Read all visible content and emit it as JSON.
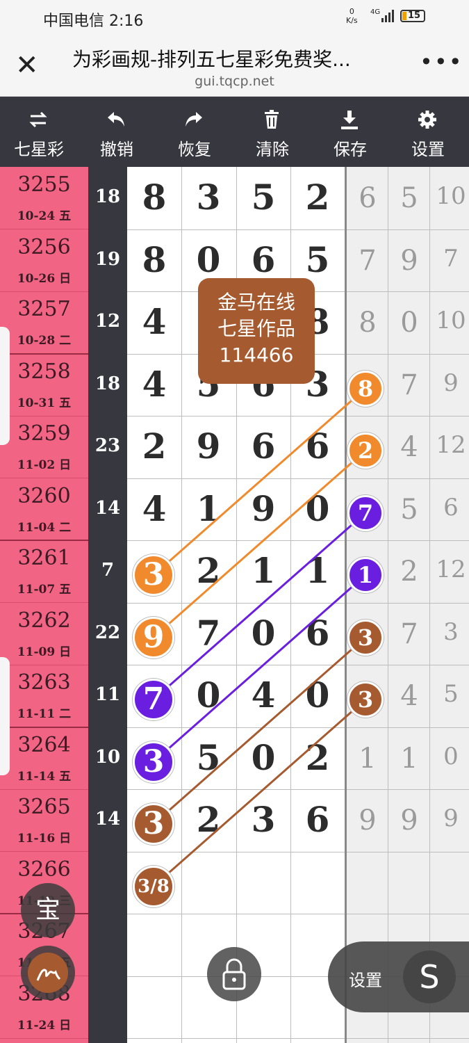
{
  "status_bar": {
    "carrier_time": "中国电信 2:16",
    "net_speed": "0",
    "net_unit": "K/s",
    "net_type": "4G",
    "battery": "15"
  },
  "browser": {
    "title": "为彩画规-排列五七星彩免费奖...",
    "url": "gui.tqcp.net"
  },
  "toolbar": [
    {
      "label": "七星彩",
      "icon": "swap-icon"
    },
    {
      "label": "撤销",
      "icon": "undo-icon"
    },
    {
      "label": "恢复",
      "icon": "redo-icon"
    },
    {
      "label": "清除",
      "icon": "trash-icon"
    },
    {
      "label": "保存",
      "icon": "download-icon"
    },
    {
      "label": "设置",
      "icon": "gear-icon"
    }
  ],
  "rows": [
    {
      "period": "3255",
      "date": "10-24 五",
      "sum": "18",
      "digits": [
        "8",
        "3",
        "5",
        "2"
      ],
      "tail": [
        "6",
        "5",
        "10"
      ]
    },
    {
      "period": "3256",
      "date": "10-26 日",
      "sum": "19",
      "digits": [
        "8",
        "0",
        "6",
        "5"
      ],
      "tail": [
        "7",
        "9",
        "7"
      ]
    },
    {
      "period": "3257",
      "date": "10-28 二",
      "sum": "12",
      "digits": [
        "4",
        "",
        "",
        "8"
      ],
      "tail": [
        "8",
        "0",
        "10"
      ]
    },
    {
      "period": "3258",
      "date": "10-31 五",
      "sum": "18",
      "digits": [
        "4",
        "5",
        "6",
        "3"
      ],
      "tail": [
        "",
        "7",
        "9"
      ]
    },
    {
      "period": "3259",
      "date": "11-02 日",
      "sum": "23",
      "digits": [
        "2",
        "9",
        "6",
        "6"
      ],
      "tail": [
        "",
        "4",
        "12"
      ]
    },
    {
      "period": "3260",
      "date": "11-04 二",
      "sum": "14",
      "digits": [
        "4",
        "1",
        "9",
        "0"
      ],
      "tail": [
        "",
        "5",
        "6"
      ]
    },
    {
      "period": "3261",
      "date": "11-07 五",
      "sum": "7",
      "digits": [
        "",
        "2",
        "1",
        "1"
      ],
      "tail": [
        "",
        "2",
        "12"
      ]
    },
    {
      "period": "3262",
      "date": "11-09 日",
      "sum": "22",
      "digits": [
        "",
        "7",
        "0",
        "6"
      ],
      "tail": [
        "",
        "7",
        "3"
      ]
    },
    {
      "period": "3263",
      "date": "11-11 二",
      "sum": "11",
      "digits": [
        "",
        "0",
        "4",
        "0"
      ],
      "tail": [
        "",
        "4",
        "5"
      ]
    },
    {
      "period": "3264",
      "date": "11-14 五",
      "sum": "10",
      "digits": [
        "",
        "5",
        "0",
        "2"
      ],
      "tail": [
        "1",
        "1",
        "0"
      ]
    },
    {
      "period": "3265",
      "date": "11-16 日",
      "sum": "14",
      "digits": [
        "",
        "2",
        "3",
        "6"
      ],
      "tail": [
        "9",
        "9",
        "9"
      ]
    },
    {
      "period": "3266",
      "date": "11-19 三",
      "sum": "",
      "digits": [
        "",
        "",
        "",
        ""
      ],
      "tail": [
        "",
        "",
        ""
      ]
    },
    {
      "period": "3267",
      "date": "11-21 五",
      "sum": "",
      "digits": [
        "",
        "",
        "",
        ""
      ],
      "tail": [
        "",
        "",
        ""
      ]
    },
    {
      "period": "3268",
      "date": "11-24 日",
      "sum": "",
      "digits": [
        "",
        "",
        "",
        ""
      ],
      "tail": [
        "",
        "",
        ""
      ]
    }
  ],
  "markers": [
    {
      "value": "8",
      "row": 3,
      "col": 4,
      "color": "#f08a2c"
    },
    {
      "value": "2",
      "row": 4,
      "col": 4,
      "color": "#f08a2c"
    },
    {
      "value": "7",
      "row": 5,
      "col": 4,
      "color": "#6a1fe0"
    },
    {
      "value": "1",
      "row": 6,
      "col": 4,
      "color": "#6a1fe0"
    },
    {
      "value": "3",
      "row": 7,
      "col": 4,
      "color": "#a65a2f"
    },
    {
      "value": "3",
      "row": 8,
      "col": 4,
      "color": "#a65a2f"
    },
    {
      "value": "3",
      "row": 6,
      "col": 0,
      "color": "#f08a2c"
    },
    {
      "value": "9",
      "row": 7,
      "col": 0,
      "color": "#f08a2c"
    },
    {
      "value": "7",
      "row": 8,
      "col": 0,
      "color": "#6a1fe0"
    },
    {
      "value": "3",
      "row": 9,
      "col": 0,
      "color": "#6a1fe0"
    },
    {
      "value": "3",
      "row": 10,
      "col": 0,
      "color": "#a65a2f"
    },
    {
      "value": "3/8",
      "row": 11,
      "col": 0,
      "color": "#a65a2f"
    }
  ],
  "tag": {
    "line1": "金马在线",
    "line2": "七星作品",
    "line3": "114466"
  },
  "floating": {
    "bao_label": "宝",
    "settings_label": "设置",
    "s_label": "S"
  }
}
